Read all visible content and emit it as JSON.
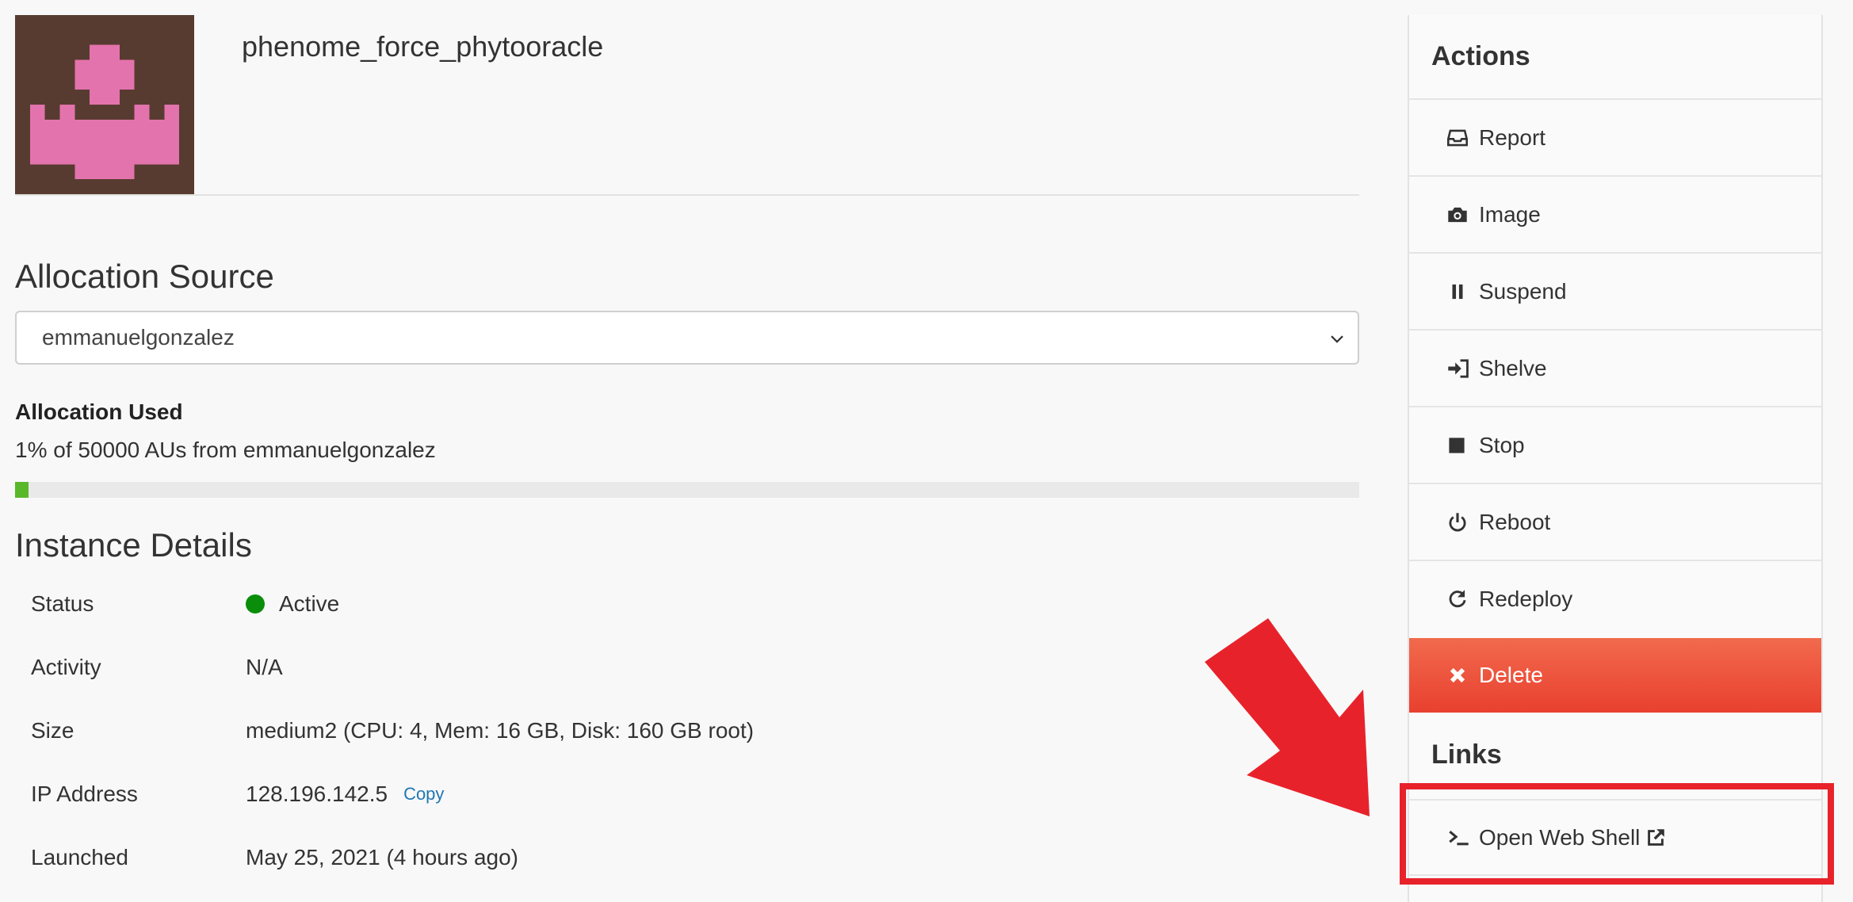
{
  "instance": {
    "name": "phenome_force_phytooracle"
  },
  "allocation": {
    "section_title": "Allocation Source",
    "selected_source": "emmanuelgonzalez",
    "used_label": "Allocation Used",
    "used_text": "1% of 50000 AUs from emmanuelgonzalez",
    "used_fraction": 0.01,
    "progress_color": "#59b82a"
  },
  "details": {
    "section_title": "Instance Details",
    "status": {
      "label": "Status",
      "value": "Active",
      "color": "#0a8d0a"
    },
    "activity": {
      "label": "Activity",
      "value": "N/A"
    },
    "size": {
      "label": "Size",
      "value": "medium2 (CPU: 4, Mem: 16 GB, Disk: 160 GB root)"
    },
    "ip": {
      "label": "IP Address",
      "value": "128.196.142.5",
      "copy_label": "Copy"
    },
    "launched": {
      "label": "Launched",
      "value": "May 25, 2021 (4 hours ago)"
    }
  },
  "actions": {
    "heading": "Actions",
    "items": [
      {
        "label": "Report",
        "icon": "inbox-icon"
      },
      {
        "label": "Image",
        "icon": "camera-icon"
      },
      {
        "label": "Suspend",
        "icon": "pause-icon"
      },
      {
        "label": "Shelve",
        "icon": "sign-in-icon"
      },
      {
        "label": "Stop",
        "icon": "stop-icon"
      },
      {
        "label": "Reboot",
        "icon": "power-icon"
      },
      {
        "label": "Redeploy",
        "icon": "redo-icon"
      },
      {
        "label": "Delete",
        "icon": "times-icon",
        "color": "#e8402f"
      }
    ]
  },
  "links": {
    "heading": "Links",
    "web_shell_label": "Open Web Shell",
    "icon": "terminal-icon"
  },
  "annotation": {
    "color": "#e8222b",
    "arrow_icon": "arrow-down-right-icon"
  }
}
